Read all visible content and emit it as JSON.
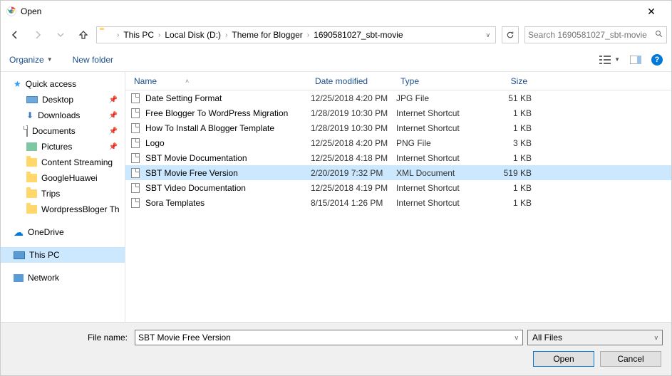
{
  "window": {
    "title": "Open"
  },
  "breadcrumb": {
    "items": [
      "This PC",
      "Local Disk (D:)",
      "Theme for Blogger",
      "1690581027_sbt-movie"
    ]
  },
  "search": {
    "placeholder": "Search 1690581027_sbt-movie"
  },
  "toolbar": {
    "organize": "Organize",
    "newfolder": "New folder"
  },
  "sidebar": {
    "quick": "Quick access",
    "quick_items": [
      {
        "label": "Desktop",
        "pin": true
      },
      {
        "label": "Downloads",
        "pin": true
      },
      {
        "label": "Documents",
        "pin": true
      },
      {
        "label": "Pictures",
        "pin": true
      },
      {
        "label": "Content Streaming",
        "pin": false
      },
      {
        "label": "GoogleHuawei",
        "pin": false
      },
      {
        "label": "Trips",
        "pin": false
      },
      {
        "label": "WordpressBloger Th",
        "pin": false
      }
    ],
    "onedrive": "OneDrive",
    "thispc": "This PC",
    "network": "Network"
  },
  "columns": {
    "name": "Name",
    "date": "Date modified",
    "type": "Type",
    "size": "Size"
  },
  "files": [
    {
      "name": "Date Setting Format",
      "date": "12/25/2018 4:20 PM",
      "type": "JPG File",
      "size": "51 KB",
      "sel": false
    },
    {
      "name": "Free Blogger To WordPress Migration",
      "date": "1/28/2019 10:30 PM",
      "type": "Internet Shortcut",
      "size": "1 KB",
      "sel": false
    },
    {
      "name": "How To Install A Blogger Template",
      "date": "1/28/2019 10:30 PM",
      "type": "Internet Shortcut",
      "size": "1 KB",
      "sel": false
    },
    {
      "name": "Logo",
      "date": "12/25/2018 4:20 PM",
      "type": "PNG File",
      "size": "3 KB",
      "sel": false
    },
    {
      "name": "SBT Movie Documentation",
      "date": "12/25/2018 4:18 PM",
      "type": "Internet Shortcut",
      "size": "1 KB",
      "sel": false
    },
    {
      "name": "SBT Movie Free Version",
      "date": "2/20/2019 7:32 PM",
      "type": "XML Document",
      "size": "519 KB",
      "sel": true
    },
    {
      "name": "SBT Video Documentation",
      "date": "12/25/2018 4:19 PM",
      "type": "Internet Shortcut",
      "size": "1 KB",
      "sel": false
    },
    {
      "name": "Sora Templates",
      "date": "8/15/2014 1:26 PM",
      "type": "Internet Shortcut",
      "size": "1 KB",
      "sel": false
    }
  ],
  "bottom": {
    "filename_label": "File name:",
    "filename_value": "SBT Movie Free Version",
    "filter": "All Files",
    "open": "Open",
    "cancel": "Cancel"
  }
}
